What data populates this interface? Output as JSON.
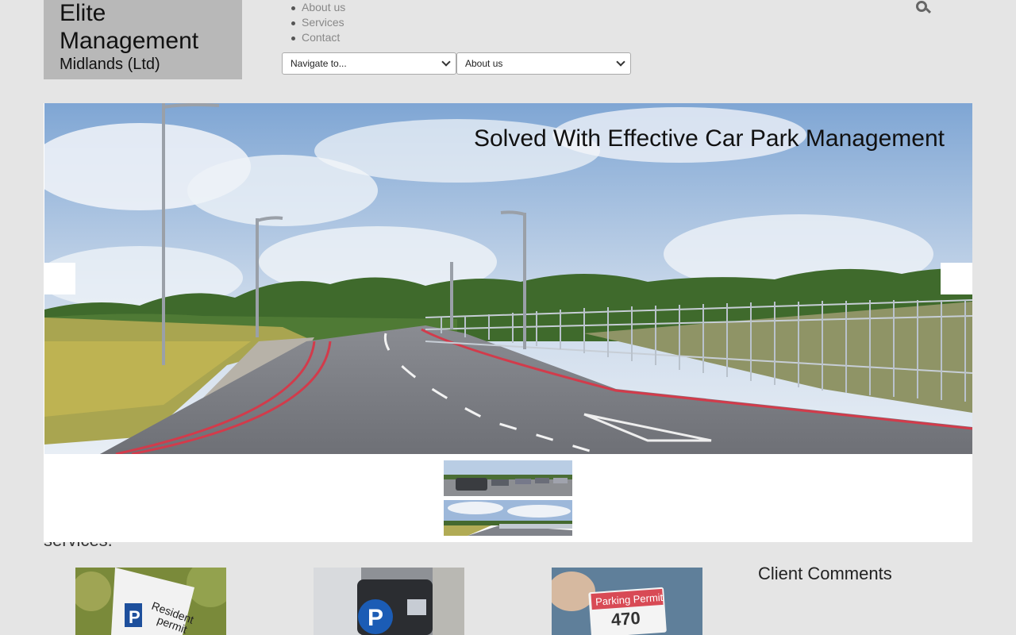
{
  "logo": {
    "line1": "Elite",
    "line2": "Management",
    "line3": "Midlands (Ltd)"
  },
  "nav": {
    "items": [
      "About us",
      "Services",
      "Contact"
    ]
  },
  "selects": {
    "navigate": "Navigate to...",
    "section": "About us"
  },
  "slider": {
    "caption": "Solved With Effective Car Park Management"
  },
  "content": {
    "partial_text": "services.",
    "comments_title": "Client Comments"
  },
  "services": [
    {
      "sign_text": "Resident",
      "sign_text2": "permit"
    },
    {
      "sign_text": "P"
    },
    {
      "sign_text": "Parking Permit",
      "number": "470"
    }
  ],
  "colors": {
    "background": "#e5e5e5",
    "logo_bg": "#b8b8b8",
    "nav_text": "#888888",
    "road_red": "#d23b4b"
  }
}
